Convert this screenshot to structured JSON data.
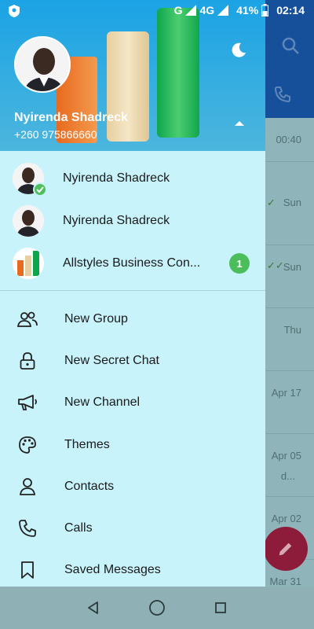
{
  "status_bar": {
    "network": "G",
    "network2": "4G",
    "battery": "41%",
    "time": "02:14"
  },
  "drawer": {
    "user": {
      "name": "Nyirenda Shadreck",
      "phone": "+260 975866660"
    },
    "accounts": [
      {
        "name": "Nyirenda Shadreck",
        "active": true
      },
      {
        "name": "Nyirenda Shadreck",
        "active": false
      },
      {
        "name": "Allstyles Business Con...",
        "badge": "1"
      }
    ],
    "menu": [
      {
        "label": "New Group",
        "icon": "people-icon"
      },
      {
        "label": "New Secret Chat",
        "icon": "lock-icon"
      },
      {
        "label": "New Channel",
        "icon": "megaphone-icon"
      },
      {
        "label": "Themes",
        "icon": "palette-icon"
      },
      {
        "label": "Contacts",
        "icon": "person-icon"
      },
      {
        "label": "Calls",
        "icon": "phone-icon"
      },
      {
        "label": "Saved Messages",
        "icon": "bookmark-icon"
      }
    ]
  },
  "background_chats": {
    "times": [
      "00:40",
      "Sun",
      "Sun",
      "Thu",
      "Apr 17",
      "Apr 05",
      "Apr 02",
      "Mar 31"
    ],
    "snippet": "d..."
  },
  "colors": {
    "drawer_bg": "#c8f3fb",
    "header_bg": "#1ba3e5",
    "badge": "#4cbd5b",
    "fab": "#8c1c3a"
  }
}
